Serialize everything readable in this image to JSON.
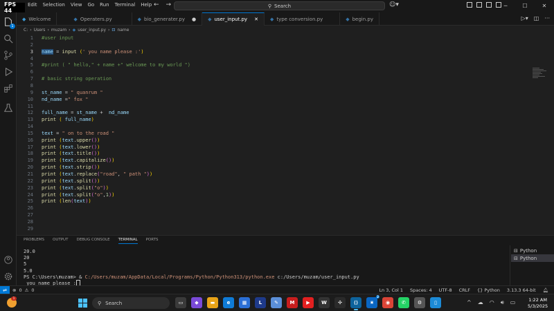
{
  "titlebar": {
    "fps": "FPS 44",
    "menu": [
      "Edit",
      "Selection",
      "View",
      "Go",
      "Run",
      "Terminal",
      "Help"
    ],
    "search_label": "Search"
  },
  "tabs": [
    {
      "label": "Welcome",
      "active": false,
      "dirty": false
    },
    {
      "label": "Operaters.py",
      "active": false,
      "dirty": false
    },
    {
      "label": "bio_generater.py",
      "active": false,
      "dirty": true
    },
    {
      "label": "user_input.py",
      "active": true,
      "dirty": false
    },
    {
      "label": "type conversion.py",
      "active": false,
      "dirty": false
    },
    {
      "label": "begin.py",
      "active": false,
      "dirty": false
    }
  ],
  "breadcrumb": [
    "C:",
    "Users",
    "muzam",
    "user_input.py",
    "name"
  ],
  "editor": {
    "current_line": 3,
    "lines": [
      {
        "n": "1",
        "text": "#user input"
      },
      {
        "n": "2",
        "text": ""
      },
      {
        "n": "3",
        "text": "name = input (' you name please :')"
      },
      {
        "n": "4",
        "text": ""
      },
      {
        "n": "5",
        "text": "#print ( \" hello,\" + name +\" welcome to my world \")"
      },
      {
        "n": "6",
        "text": ""
      },
      {
        "n": "7",
        "text": "# basic string operation"
      },
      {
        "n": "8",
        "text": ""
      },
      {
        "n": "9",
        "text": "st_name = \" quanrum \""
      },
      {
        "n": "10",
        "text": "nd_name =\" fox \""
      },
      {
        "n": "11",
        "text": ""
      },
      {
        "n": "12",
        "text": "full_name = st_name +  nd_name"
      },
      {
        "n": "13",
        "text": "print ( full_name)"
      },
      {
        "n": "14",
        "text": ""
      },
      {
        "n": "15",
        "text": "text = \" on to the road \""
      },
      {
        "n": "16",
        "text": "print (text.upper())"
      },
      {
        "n": "17",
        "text": "print (text.lower())"
      },
      {
        "n": "18",
        "text": "print (text.title())"
      },
      {
        "n": "19",
        "text": "print (text.capitalize())"
      },
      {
        "n": "20",
        "text": "print (text.strip())"
      },
      {
        "n": "21",
        "text": "print (text.replace(\"road\", \" path \"))"
      },
      {
        "n": "22",
        "text": "print (text.split())"
      },
      {
        "n": "23",
        "text": "print (text.split(\"o\"))"
      },
      {
        "n": "24",
        "text": "print (text.split(\"o\",1))"
      },
      {
        "n": "25",
        "text": "print (len(text))"
      },
      {
        "n": "26",
        "text": ""
      },
      {
        "n": "27",
        "text": ""
      },
      {
        "n": "28",
        "text": ""
      },
      {
        "n": "29",
        "text": ""
      }
    ]
  },
  "panel": {
    "tabs": [
      "PROBLEMS",
      "OUTPUT",
      "DEBUG CONSOLE",
      "TERMINAL",
      "PORTS"
    ],
    "active_tab": "TERMINAL",
    "terminal_lines": [
      "20.0",
      "20",
      "5",
      "5.0"
    ],
    "prompt": "PS C:\\Users\\muzam> & ",
    "python_path": "C:/Users/muzam/AppData/Local/Programs/Python/Python313/python.exe",
    "script_arg": " c:/Users/muzam/user_input.py",
    "input_prompt": " you name please :",
    "terminals": [
      "Python",
      "Python"
    ]
  },
  "statusbar": {
    "errors": "0",
    "warnings": "0",
    "position": "Ln 3, Col 1",
    "spaces": "Spaces: 4",
    "encoding": "UTF-8",
    "eol": "CRLF",
    "language": "Python",
    "interpreter": "3.13.3 64-bit"
  },
  "taskbar": {
    "search_label": "Search",
    "time": "1:22 AM",
    "date": "5/3/2025",
    "weather_badge": "1",
    "chat_badge": "2"
  },
  "activity_badge": "1"
}
